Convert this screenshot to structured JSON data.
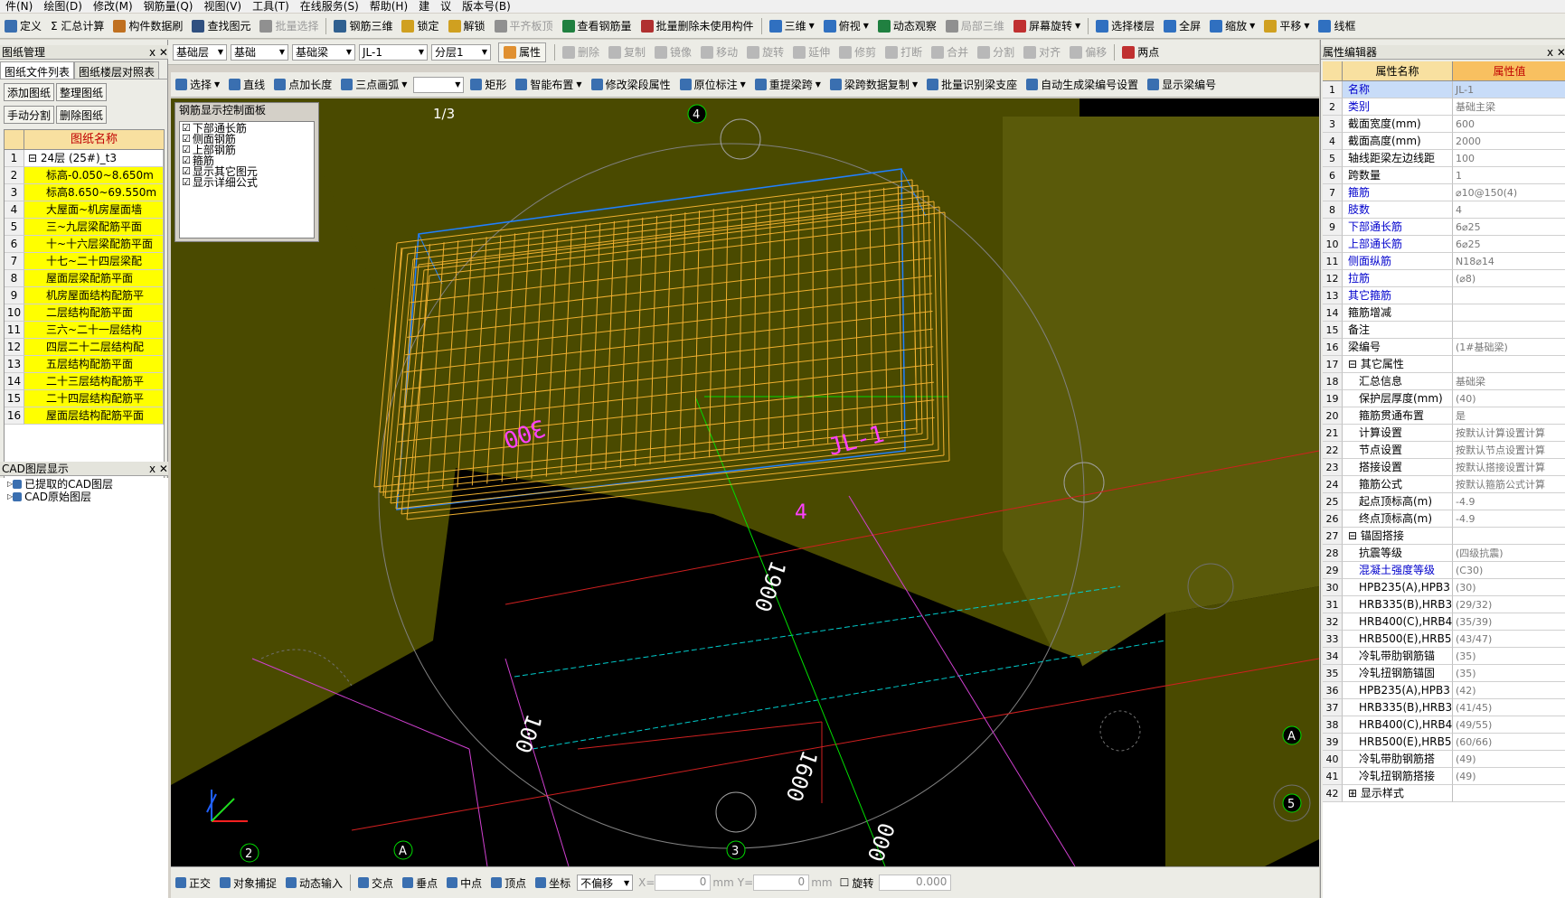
{
  "menu": [
    "件(N)",
    "绘图(D)",
    "修改(M)",
    "钢筋量(Q)",
    "视图(V)",
    "工具(T)",
    "在线服务(S)",
    "帮助(H)",
    "建",
    "议",
    "版本号(B)"
  ],
  "toolbar1": [
    {
      "label": "定义",
      "icon": "define-icon",
      "color": "#3a6fb0"
    },
    {
      "label": "Σ 汇总计算",
      "icon": "",
      "color": ""
    },
    {
      "label": "构件数据刷",
      "icon": "brush-icon",
      "color": "#c07020"
    },
    {
      "label": "查找图元",
      "icon": "binoculars-icon",
      "color": "#305080"
    },
    {
      "label": "批量选择",
      "icon": "batch-select-icon",
      "color": "#909090",
      "disabled": true
    },
    {
      "label": "钢筋三维",
      "icon": "rebar-3d-icon",
      "color": "#306090"
    },
    {
      "label": "锁定",
      "icon": "lock-icon",
      "color": "#d0a020"
    },
    {
      "label": "解锁",
      "icon": "unlock-icon",
      "color": "#d0a020"
    },
    {
      "label": "平齐板顶",
      "icon": "align-slab-icon",
      "color": "#909090",
      "disabled": true
    },
    {
      "label": "查看钢筋量",
      "icon": "view-rebar-icon",
      "color": "#208040"
    },
    {
      "label": "批量删除未使用构件",
      "icon": "batch-delete-icon",
      "color": "#b03030"
    },
    {
      "label": "三维",
      "icon": "3d-icon",
      "color": "#3070c0",
      "dropdown": true
    },
    {
      "label": "俯视",
      "icon": "top-view-icon",
      "color": "#3070c0",
      "dropdown": true
    },
    {
      "label": "动态观察",
      "icon": "orbit-icon",
      "color": "#208040"
    },
    {
      "label": "局部三维",
      "icon": "local-3d-icon",
      "color": "#909090",
      "disabled": true
    },
    {
      "label": "屏幕旋转",
      "icon": "screen-rotate-icon",
      "color": "#c03030",
      "dropdown": true
    },
    {
      "label": "选择楼层",
      "icon": "select-floor-icon",
      "color": "#3070c0"
    },
    {
      "label": "全屏",
      "icon": "fullscreen-icon",
      "color": "#3070c0"
    },
    {
      "label": "缩放",
      "icon": "zoom-icon",
      "color": "#3070c0",
      "dropdown": true
    },
    {
      "label": "平移",
      "icon": "pan-icon",
      "color": "#d0a020",
      "dropdown": true
    },
    {
      "label": "线框",
      "icon": "wireframe-icon",
      "color": "#3070c0"
    }
  ],
  "toolbar2": {
    "combos": [
      {
        "value": "基础层"
      },
      {
        "value": "基础"
      },
      {
        "value": "基础梁"
      },
      {
        "value": "JL-1"
      },
      {
        "value": "分层1"
      }
    ],
    "props_label": "属性",
    "items": [
      {
        "label": "删除",
        "icon": "delete-icon",
        "disabled": true
      },
      {
        "label": "复制",
        "icon": "copy-icon",
        "disabled": true
      },
      {
        "label": "镜像",
        "icon": "mirror-icon",
        "disabled": true
      },
      {
        "label": "移动",
        "icon": "move-icon",
        "disabled": true
      },
      {
        "label": "旋转",
        "icon": "rotate-icon",
        "disabled": true
      },
      {
        "label": "延伸",
        "icon": "extend-icon",
        "disabled": true
      },
      {
        "label": "修剪",
        "icon": "trim-icon",
        "disabled": true
      },
      {
        "label": "打断",
        "icon": "break-icon",
        "disabled": true
      },
      {
        "label": "合并",
        "icon": "merge-icon",
        "disabled": true
      },
      {
        "label": "分割",
        "icon": "split-icon",
        "disabled": true
      },
      {
        "label": "对齐",
        "icon": "align-icon",
        "disabled": true
      },
      {
        "label": "偏移",
        "icon": "offset-icon",
        "disabled": true
      },
      {
        "label": "两点",
        "icon": "two-point-icon",
        "disabled": false
      }
    ]
  },
  "toolbar3": [
    {
      "label": "选择",
      "icon": "select-cursor-icon",
      "dropdown": true
    },
    {
      "label": "直线",
      "icon": "line-icon"
    },
    {
      "label": "点加长度",
      "icon": "point-length-icon"
    },
    {
      "label": "三点画弧",
      "icon": "arc-icon",
      "dropdown": true
    },
    {
      "label": "",
      "icon": "",
      "combo": true
    },
    {
      "label": "矩形",
      "icon": "rectangle-icon"
    },
    {
      "label": "智能布置",
      "icon": "smart-place-icon",
      "dropdown": true
    },
    {
      "label": "修改梁段属性",
      "icon": "modify-beam-icon"
    },
    {
      "label": "原位标注",
      "icon": "in-situ-icon",
      "dropdown": true
    },
    {
      "label": "重提梁跨",
      "icon": "re-span-icon",
      "dropdown": true
    },
    {
      "label": "梁跨数据复制",
      "icon": "span-copy-icon",
      "dropdown": true
    },
    {
      "label": "批量识别梁支座",
      "icon": "batch-support-icon"
    },
    {
      "label": "自动生成梁编号设置",
      "icon": "auto-number-icon"
    },
    {
      "label": "显示梁编号",
      "icon": "show-number-icon"
    }
  ],
  "left_panel": {
    "title": "图纸管理",
    "tabs": [
      "图纸文件列表",
      "图纸楼层对照表"
    ],
    "buttons": [
      "添加图纸",
      "整理图纸",
      "手动分割",
      "删除图纸"
    ],
    "column_header": "图纸名称",
    "rows": [
      {
        "num": "1",
        "name": "24层 (25#)_t3",
        "group": true
      },
      {
        "num": "2",
        "name": "标高-0.050~8.650m"
      },
      {
        "num": "3",
        "name": "标高8.650~69.550m"
      },
      {
        "num": "4",
        "name": "大屋面~机房屋面墙"
      },
      {
        "num": "5",
        "name": "三~九层梁配筋平面"
      },
      {
        "num": "6",
        "name": "十~十六层梁配筋平面"
      },
      {
        "num": "7",
        "name": "十七~二十四层梁配"
      },
      {
        "num": "8",
        "name": "屋面层梁配筋平面"
      },
      {
        "num": "9",
        "name": "机房屋面结构配筋平"
      },
      {
        "num": "10",
        "name": "二层结构配筋平面"
      },
      {
        "num": "11",
        "name": "三六~二十一层结构"
      },
      {
        "num": "12",
        "name": "四层二十二层结构配"
      },
      {
        "num": "13",
        "name": "五层结构配筋平面"
      },
      {
        "num": "14",
        "name": "二十三层结构配筋平"
      },
      {
        "num": "15",
        "name": "二十四层结构配筋平"
      },
      {
        "num": "16",
        "name": "屋面层结构配筋平面"
      }
    ],
    "cad_title": "CAD图层显示",
    "cad_items": [
      "已提取的CAD图层",
      "CAD原始图层"
    ]
  },
  "rebar_panel": {
    "title": "钢筋显示控制面板",
    "items": [
      "下部通长筋",
      "侧面钢筋",
      "上部钢筋",
      "箍筋",
      "显示其它图元",
      "显示详细公式"
    ]
  },
  "viewport": {
    "axis_labels_top": [
      "1/3",
      "4"
    ],
    "axis_labels_bottom": [
      "2",
      "A",
      "3"
    ],
    "axis_labels_right": [
      "A",
      "5"
    ],
    "dims": [
      "1900",
      "1600",
      "100",
      "000",
      "4"
    ],
    "magenta_text": [
      "JL-1",
      "300"
    ]
  },
  "statusbar": {
    "items": [
      "正交",
      "对象捕捉",
      "动态输入",
      "交点",
      "垂点",
      "中点",
      "顶点",
      "坐标"
    ],
    "offset_combo": "不偏移",
    "x_label": "X=",
    "x_value": "0",
    "unit1": "mm",
    "y_label": "Y=",
    "y_value": "0",
    "unit2": "mm",
    "rotate_label": "旋转",
    "rotate_value": "0.000"
  },
  "properties": {
    "title": "属性编辑器",
    "col_name": "属性名称",
    "col_value": "属性值",
    "rows": [
      {
        "n": "1",
        "name": "名称",
        "value": "JL-1",
        "blue": true
      },
      {
        "n": "2",
        "name": "类别",
        "value": "基础主梁",
        "blue": true
      },
      {
        "n": "3",
        "name": "截面宽度(mm)",
        "value": "600"
      },
      {
        "n": "4",
        "name": "截面高度(mm)",
        "value": "2000"
      },
      {
        "n": "5",
        "name": "轴线距梁左边线距",
        "value": "100"
      },
      {
        "n": "6",
        "name": "跨数量",
        "value": "1"
      },
      {
        "n": "7",
        "name": "箍筋",
        "value": "⌀10@150(4)",
        "blue": true
      },
      {
        "n": "8",
        "name": "肢数",
        "value": "4",
        "blue": true
      },
      {
        "n": "9",
        "name": "下部通长筋",
        "value": "6⌀25",
        "blue": true
      },
      {
        "n": "10",
        "name": "上部通长筋",
        "value": "6⌀25",
        "blue": true
      },
      {
        "n": "11",
        "name": "侧面纵筋",
        "value": "N18⌀14",
        "blue": true
      },
      {
        "n": "12",
        "name": "拉筋",
        "value": "(⌀8)",
        "blue": true
      },
      {
        "n": "13",
        "name": "其它箍筋",
        "value": "",
        "blue": true
      },
      {
        "n": "14",
        "name": "箍筋增减",
        "value": ""
      },
      {
        "n": "15",
        "name": "备注",
        "value": ""
      },
      {
        "n": "16",
        "name": "梁编号",
        "value": "(1#基础梁)"
      },
      {
        "n": "17",
        "name": "其它属性",
        "value": "",
        "group": true
      },
      {
        "n": "18",
        "name": "汇总信息",
        "value": "基础梁",
        "indent": true
      },
      {
        "n": "19",
        "name": "保护层厚度(mm)",
        "value": "(40)",
        "indent": true
      },
      {
        "n": "20",
        "name": "箍筋贯通布置",
        "value": "是",
        "indent": true
      },
      {
        "n": "21",
        "name": "计算设置",
        "value": "按默认计算设置计算",
        "indent": true
      },
      {
        "n": "22",
        "name": "节点设置",
        "value": "按默认节点设置计算",
        "indent": true
      },
      {
        "n": "23",
        "name": "搭接设置",
        "value": "按默认搭接设置计算",
        "indent": true
      },
      {
        "n": "24",
        "name": "箍筋公式",
        "value": "按默认箍筋公式计算",
        "indent": true
      },
      {
        "n": "25",
        "name": "起点顶标高(m)",
        "value": "-4.9",
        "indent": true
      },
      {
        "n": "26",
        "name": "终点顶标高(m)",
        "value": "-4.9",
        "indent": true
      },
      {
        "n": "27",
        "name": "锚固搭接",
        "value": "",
        "group": true
      },
      {
        "n": "28",
        "name": "抗震等级",
        "value": "(四级抗震)",
        "indent": true
      },
      {
        "n": "29",
        "name": "混凝土强度等级",
        "value": "(C30)",
        "indent": true,
        "blue": true
      },
      {
        "n": "30",
        "name": "HPB235(A),HPB3",
        "value": "(30)",
        "indent": true
      },
      {
        "n": "31",
        "name": "HRB335(B),HRB3",
        "value": "(29/32)",
        "indent": true
      },
      {
        "n": "32",
        "name": "HRB400(C),HRB4",
        "value": "(35/39)",
        "indent": true
      },
      {
        "n": "33",
        "name": "HRB500(E),HRB5",
        "value": "(43/47)",
        "indent": true
      },
      {
        "n": "34",
        "name": "冷轧带肋钢筋锚",
        "value": "(35)",
        "indent": true
      },
      {
        "n": "35",
        "name": "冷轧扭钢筋锚固",
        "value": "(35)",
        "indent": true
      },
      {
        "n": "36",
        "name": "HPB235(A),HPB3",
        "value": "(42)",
        "indent": true
      },
      {
        "n": "37",
        "name": "HRB335(B),HRB3",
        "value": "(41/45)",
        "indent": true
      },
      {
        "n": "38",
        "name": "HRB400(C),HRB4",
        "value": "(49/55)",
        "indent": true
      },
      {
        "n": "39",
        "name": "HRB500(E),HRB5",
        "value": "(60/66)",
        "indent": true
      },
      {
        "n": "40",
        "name": "冷轧带肋钢筋搭",
        "value": "(49)",
        "indent": true
      },
      {
        "n": "41",
        "name": "冷轧扭钢筋搭接",
        "value": "(49)",
        "indent": true
      },
      {
        "n": "42",
        "name": "显示样式",
        "value": "",
        "group": true,
        "collapsed": true
      }
    ]
  }
}
